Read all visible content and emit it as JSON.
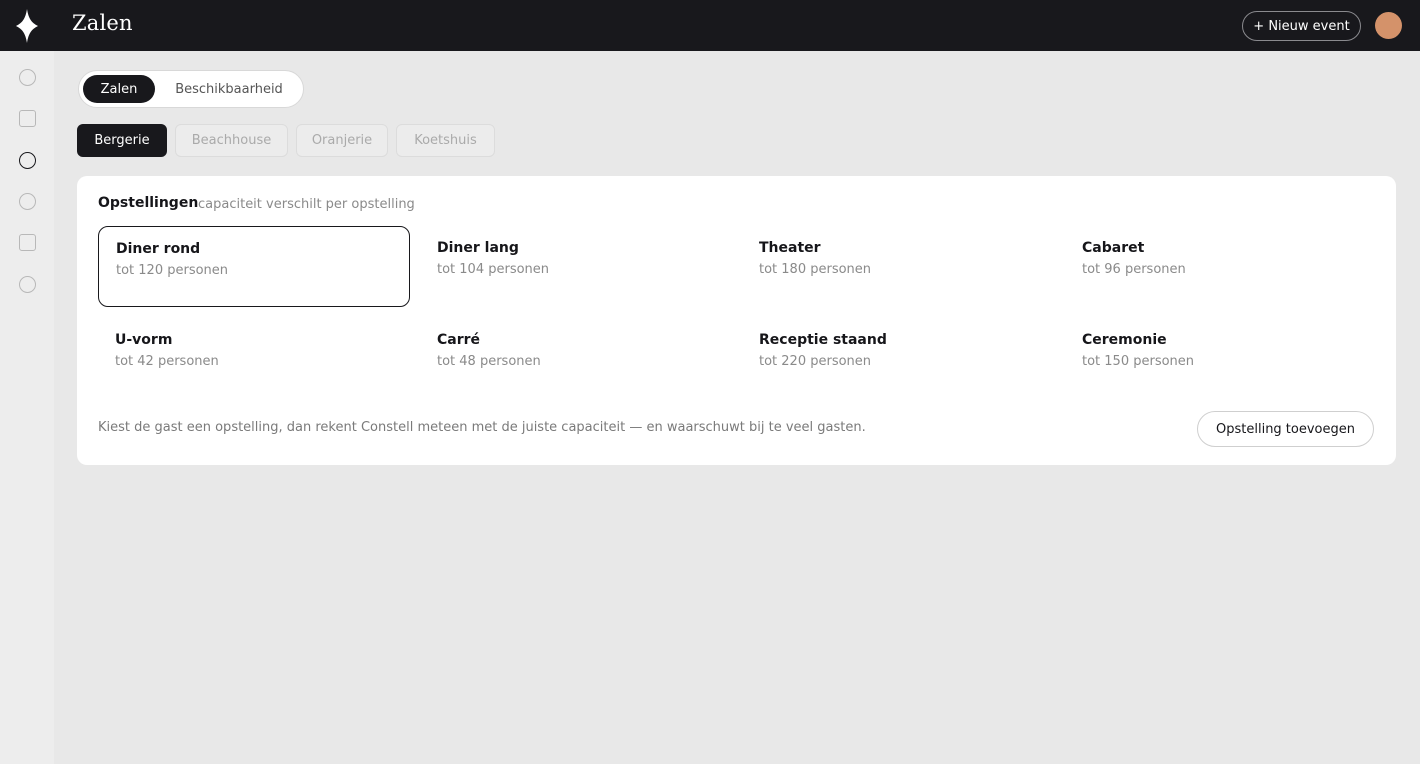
{
  "header": {
    "title": "Zalen",
    "new_event_label": "+ Nieuw event"
  },
  "sidebar": {
    "logo_icon": "diamond-star-icon",
    "items": [
      {
        "icon": "circle-icon",
        "active": false
      },
      {
        "icon": "square-icon",
        "active": false
      },
      {
        "icon": "circle-icon",
        "active": true
      },
      {
        "icon": "circle-icon",
        "active": false
      },
      {
        "icon": "square-icon",
        "active": false
      },
      {
        "icon": "circle-icon",
        "active": false
      }
    ]
  },
  "segmented": {
    "options": [
      "Zalen",
      "Beschikbaarheid"
    ],
    "selected": "Zalen"
  },
  "venues": {
    "tabs": [
      "Bergerie",
      "Beachhouse",
      "Oranjerie",
      "Koetshuis"
    ],
    "selected": "Bergerie"
  },
  "setups_card": {
    "title": "Opstellingen",
    "subtitle": "capaciteit verschilt per opstelling",
    "items": [
      {
        "name": "Diner rond",
        "capacity": "tot 120 personen",
        "selected": true
      },
      {
        "name": "Diner lang",
        "capacity": "tot 104 personen",
        "selected": false
      },
      {
        "name": "Theater",
        "capacity": "tot 180 personen",
        "selected": false
      },
      {
        "name": "Cabaret",
        "capacity": "tot 96 personen",
        "selected": false
      },
      {
        "name": "U-vorm",
        "capacity": "tot 42 personen",
        "selected": false
      },
      {
        "name": "Carré",
        "capacity": "tot 48 personen",
        "selected": false
      },
      {
        "name": "Receptie staand",
        "capacity": "tot 220 personen",
        "selected": false
      },
      {
        "name": "Ceremonie",
        "capacity": "tot 150 personen",
        "selected": false
      }
    ],
    "note": "Kiest de gast een opstelling, dan rekent Constell meteen met de juiste capaciteit — en waarschuwt bij te veel gasten.",
    "add_label": "Opstelling toevoegen"
  },
  "colors": {
    "dark": "#18181c",
    "background": "#e8e8e8",
    "avatar": "#d4926a"
  }
}
